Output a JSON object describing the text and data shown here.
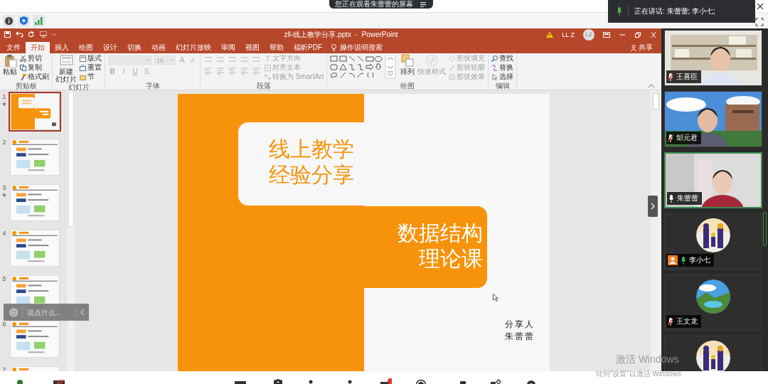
{
  "share_banner": {
    "text": "您正在观看朱蕾蕾的屏幕"
  },
  "speaking_popup": {
    "text": "正在讲话: 朱蕾蕾; 李小七;"
  },
  "powerpoint": {
    "title": "zll-线上教学分享.pptx  -  PowerPoint",
    "user": "LL Z",
    "user_avatar": "LZ",
    "tabs": [
      {
        "label": "文件",
        "selected": false
      },
      {
        "label": "开始",
        "selected": true
      },
      {
        "label": "插入",
        "selected": false
      },
      {
        "label": "绘图",
        "selected": false
      },
      {
        "label": "设计",
        "selected": false
      },
      {
        "label": "切换",
        "selected": false
      },
      {
        "label": "动画",
        "selected": false
      },
      {
        "label": "幻灯片放映",
        "selected": false
      },
      {
        "label": "审阅",
        "selected": false
      },
      {
        "label": "视图",
        "selected": false
      },
      {
        "label": "帮助",
        "selected": false
      },
      {
        "label": "福昕PDF",
        "selected": false
      }
    ],
    "tell_me": "操作说明搜索",
    "share": "共享",
    "ribbon_groups": [
      {
        "label": "剪贴板",
        "items": [
          {
            "kind": "large",
            "lines": [
              "粘贴"
            ],
            "disabled": false
          },
          {
            "kind": "small",
            "label": "剪切",
            "disabled": false
          },
          {
            "kind": "small",
            "label": "复制",
            "disabled": false
          },
          {
            "kind": "small",
            "label": "格式刷",
            "disabled": false
          }
        ]
      },
      {
        "label": "幻灯片",
        "items": [
          {
            "kind": "large",
            "lines": [
              "新建",
              "幻灯片"
            ],
            "disabled": false
          },
          {
            "kind": "small",
            "label": "版式",
            "disabled": false
          },
          {
            "kind": "small",
            "label": "重置",
            "disabled": false
          },
          {
            "kind": "small",
            "label": "节",
            "disabled": false
          }
        ]
      },
      {
        "label": "字体",
        "items": [
          {
            "kind": "combo",
            "value": "16",
            "size_buttons": [
              "A",
              "A"
            ],
            "disabled": true
          },
          {
            "kind": "glyphs",
            "labels": [
              "B",
              "I",
              "U",
              "S"
            ],
            "disabled": true
          }
        ]
      },
      {
        "label": "段落",
        "items": [
          {
            "kind": "icon_grid",
            "disabled": true
          },
          {
            "kind": "small",
            "label": "文字方向",
            "disabled": true
          },
          {
            "kind": "small",
            "label": "对齐文本",
            "disabled": true
          },
          {
            "kind": "small",
            "label": "转换为 SmartArt",
            "disabled": true
          }
        ]
      },
      {
        "label": "绘图",
        "items": [
          {
            "kind": "gallery",
            "disabled": false
          },
          {
            "kind": "large",
            "lines": [
              "排列"
            ],
            "disabled": false
          },
          {
            "kind": "large",
            "lines": [
              "快速样式"
            ],
            "disabled": true
          },
          {
            "kind": "small",
            "label": "形状填充",
            "disabled": true
          },
          {
            "kind": "small",
            "label": "形状轮廓",
            "disabled": true
          },
          {
            "kind": "small",
            "label": "形状效果",
            "disabled": true
          }
        ]
      },
      {
        "label": "编辑",
        "items": [
          {
            "kind": "small",
            "label": "查找",
            "disabled": false
          },
          {
            "kind": "small",
            "label": "替换",
            "disabled": false
          },
          {
            "kind": "small",
            "label": "选择",
            "disabled": false
          }
        ]
      }
    ],
    "slides": [
      {
        "number": "1",
        "kind": "title",
        "starred": true,
        "selected": true
      },
      {
        "number": "2",
        "kind": "content",
        "starred": false,
        "selected": false
      },
      {
        "number": "3",
        "kind": "content",
        "starred": true,
        "selected": false
      },
      {
        "number": "4",
        "kind": "content",
        "starred": false,
        "selected": false
      },
      {
        "number": "5",
        "kind": "content",
        "starred": false,
        "selected": false
      },
      {
        "number": "6",
        "kind": "content",
        "starred": false,
        "selected": false
      },
      {
        "number": "7",
        "kind": "content",
        "selected": false
      }
    ],
    "slide": {
      "heading": [
        "线上教学",
        "经验分享"
      ],
      "subject": [
        "数据结构",
        "理论课"
      ],
      "presenter_label": "分享人",
      "presenter": "朱蕾蕾"
    }
  },
  "chat": {
    "placeholder": "说点什么..."
  },
  "participants": [
    {
      "name": "王喜臣",
      "kind": "video",
      "muted": true,
      "speaking": false,
      "active": false,
      "host": false
    },
    {
      "name": "邹元君",
      "kind": "video",
      "muted": true,
      "speaking": false,
      "active": false,
      "host": false
    },
    {
      "name": "朱蕾蕾",
      "kind": "video",
      "muted": false,
      "speaking": false,
      "active": true,
      "host": false
    },
    {
      "name": "李小七",
      "kind": "avatar",
      "muted": false,
      "speaking": true,
      "active": false,
      "host": true
    },
    {
      "name": "王文龙",
      "kind": "avatar",
      "muted": true,
      "speaking": false,
      "active": false,
      "host": false
    },
    {
      "kind": "avatar"
    }
  ],
  "windows_activation": {
    "title": "激活 Windows",
    "hint": "转到“设置”以激活 Windows"
  }
}
